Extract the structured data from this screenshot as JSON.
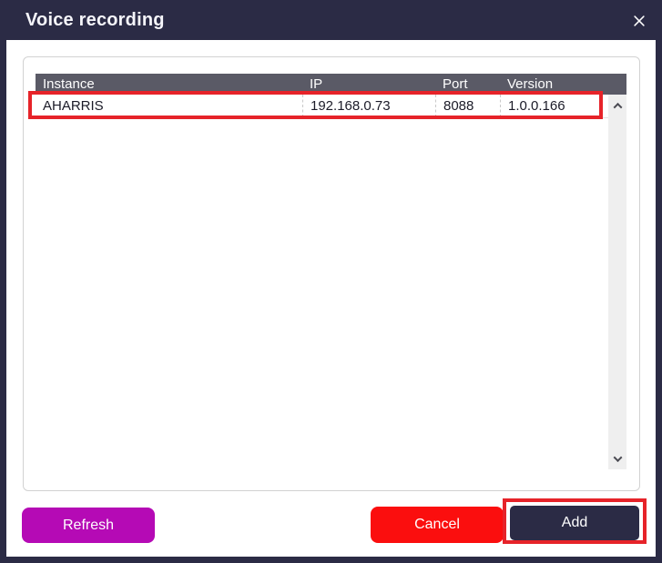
{
  "dialog": {
    "title": "Voice recording",
    "close_icon": "x-close-icon"
  },
  "table": {
    "columns": [
      "Instance",
      "IP",
      "Port",
      "Version"
    ],
    "rows": [
      {
        "instance": "AHARRIS",
        "ip": "192.168.0.73",
        "port": "8088",
        "version": "1.0.0.166"
      }
    ],
    "scrollbar": {
      "up_icon": "chevron-up",
      "down_icon": "chevron-down"
    }
  },
  "buttons": {
    "refresh": "Refresh",
    "cancel": "Cancel",
    "add": "Add"
  },
  "colors": {
    "frame_navy": "#2b2b45",
    "table_header_gray": "#5a5a66",
    "refresh_magenta": "#b50ab5",
    "cancel_red": "#fb0e0e",
    "annotation_red": "#e62329",
    "scrollbar_track": "#efefef"
  },
  "annotations": {
    "row_highlight": "red rectangle around AHARRIS row",
    "add_highlight": "red rectangle around Add button"
  }
}
